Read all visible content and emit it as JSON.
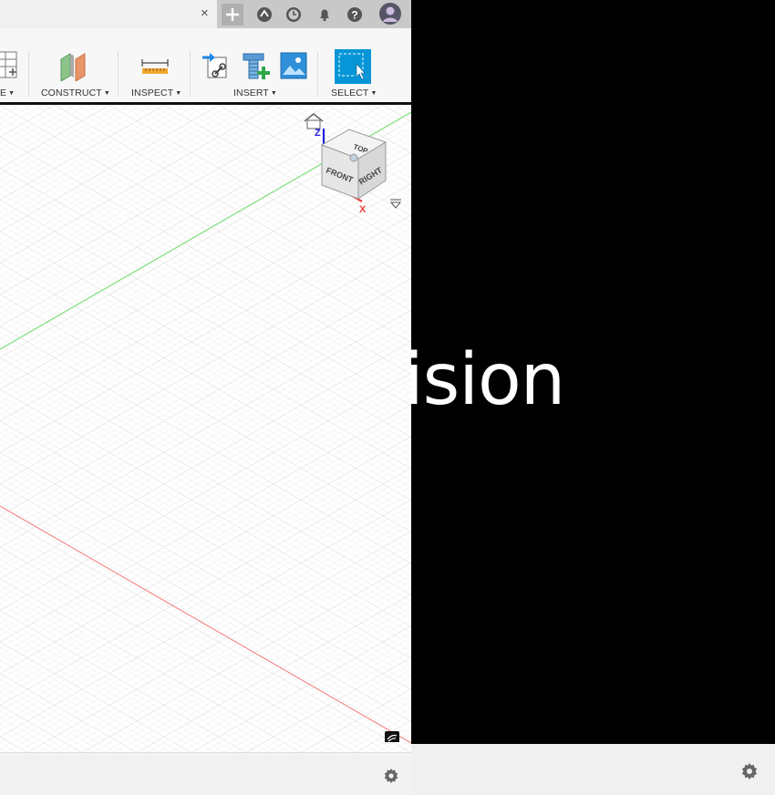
{
  "tab": {
    "close_glyph": "×"
  },
  "toolbar": {
    "groups": [
      {
        "label": "E",
        "icon": "create-form-icon"
      },
      {
        "label": "CONSTRUCT",
        "icon": "construct-plane-icon"
      },
      {
        "label": "INSPECT",
        "icon": "measure-icon"
      },
      {
        "label": "INSERT",
        "icon": "insert-icons"
      },
      {
        "label": "SELECT",
        "icon": "select-icon"
      }
    ]
  },
  "viewcube": {
    "top": "TOP",
    "front": "FRONT",
    "right": "RIGHT",
    "axis_z": "Z",
    "axis_x": "X"
  },
  "splash": {
    "text": "ision"
  },
  "colors": {
    "x_axis": "#f04040",
    "y_axis": "#40d040",
    "z_axis": "#2020e0",
    "select_blue": "#0696d7"
  }
}
